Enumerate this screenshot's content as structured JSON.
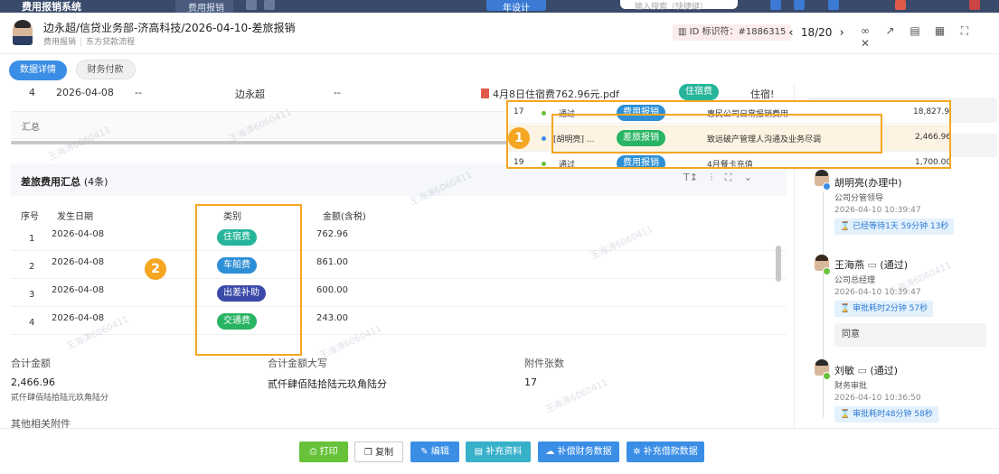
{
  "top_bar": {
    "system_name": "费用报销系统",
    "tab_label": "费用报销",
    "create_label": "年设计",
    "search_placeholder": "输入搜索（快捷键）"
  },
  "header": {
    "title": "边永超/信贷业务部-济高科技/2026-04-10-差旅报销",
    "sub_type": "费用报销",
    "sub_flow": "东方贷款流程",
    "id_label": "ID 标识符：#1886315",
    "page_current": "18/20"
  },
  "tabs": [
    {
      "label": "数据详情",
      "active": true
    },
    {
      "label": "财务付款",
      "active": false
    }
  ],
  "top_table_row": {
    "seq": "4",
    "date": "2026-04-08",
    "col3": "--",
    "person": "边永超",
    "col5": "--",
    "file": "4月8日住宿费762.96元.pdf",
    "category": "住宿费",
    "category_text": "住宿!"
  },
  "summary_label": "汇总",
  "popup_rows": [
    {
      "no": "17",
      "status": "通过",
      "tag": "费用报销",
      "desc": "惠民公司日常报销费用",
      "amount": "18,827.92",
      "dot": "#67c23a"
    },
    {
      "no": "",
      "status": "[胡明亮] ...",
      "tag": "差旅报销",
      "desc": "致远破产管理人沟通及业务尽调",
      "amount": "2,466.96",
      "dot": "#3a8ee6"
    },
    {
      "no": "19",
      "status": "通过",
      "tag": "费用报销",
      "desc": "4月餐卡充值",
      "amount": "1,700.00",
      "dot": "#67c23a"
    }
  ],
  "travel": {
    "title": "差旅费用汇总",
    "count": "(4条)",
    "columns": {
      "seq": "序号",
      "date": "发生日期",
      "category": "类别",
      "amount": "金额(含税)"
    },
    "rows": [
      {
        "seq": "1",
        "date": "2026-04-08",
        "category": "住宿费",
        "amount": "762.96",
        "color": "#26b59a"
      },
      {
        "seq": "2",
        "date": "2026-04-08",
        "category": "车船费",
        "amount": "861.00",
        "color": "#2d8fd5"
      },
      {
        "seq": "3",
        "date": "2026-04-08",
        "category": "出差补助",
        "amount": "600.00",
        "color": "#3b4aa8"
      },
      {
        "seq": "4",
        "date": "2026-04-08",
        "category": "交通费",
        "amount": "243.00",
        "color": "#28b463"
      }
    ]
  },
  "totals": {
    "total_label": "合计金额",
    "total_value": "2,466.96",
    "total_words_small": "贰仟肆佰陆拾陆元玖角陆分",
    "upper_label": "合计金额大写",
    "upper_value": "贰仟肆佰陆拾陆元玖角陆分",
    "attach_label": "附件张数",
    "attach_value": "17"
  },
  "other_attachments": "其他相关附件",
  "approvals": [
    {
      "name": "胡明亮(办理中)",
      "role": "公司分管领导",
      "time": "2026-04-10 10:39:47",
      "status": "已经等待1天 59分钟 13秒",
      "badge": "#3a8ee6"
    },
    {
      "name": "王海燕",
      "result": "(通过)",
      "role": "公司总经理",
      "time": "2026-04-10 10:39:47",
      "status": "审批耗时2分钟 57秒",
      "note": "同意",
      "badge": "#67c23a"
    },
    {
      "name": "刘敏",
      "result": "(通过)",
      "role": "财务审批",
      "time": "2026-04-10 10:36:50",
      "status": "审批耗时48分钟 58秒",
      "badge": "#67c23a"
    }
  ],
  "annotations": {
    "one": "1",
    "two": "2"
  },
  "footer": {
    "print": "打印",
    "copy": "复制",
    "edit": "编辑",
    "supplement": "补充资料",
    "finance_data": "补偿财务数据",
    "loan_data": "补充借款数据"
  },
  "watermark": "王海涛6060411",
  "colors": {
    "accent": "#3a8ee6",
    "highlight": "#f5a623",
    "success": "#67c23a"
  }
}
